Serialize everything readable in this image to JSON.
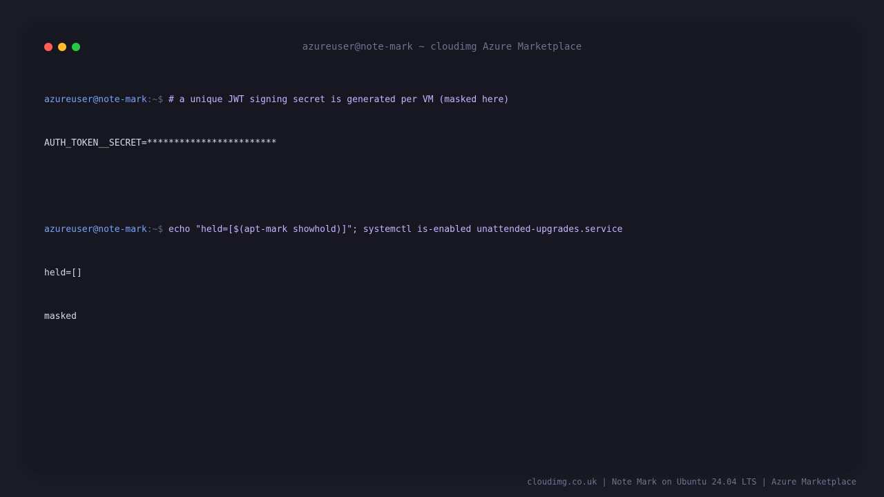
{
  "window": {
    "title": "azureuser@note-mark ~ cloudimg Azure Marketplace",
    "buttons": [
      "close",
      "minimize",
      "maximize"
    ]
  },
  "terminal": {
    "prompt_user": "azureuser@note-mark",
    "prompt_sep": ":~$",
    "lines": [
      {
        "command": "# a unique JWT signing secret is generated per VM (masked here)"
      },
      {
        "output": "AUTH_TOKEN__SECRET=************************"
      },
      {
        "command": "echo \"held=[$(apt-mark showhold)]\"; systemctl is-enabled unattended-upgrades.service"
      },
      {
        "output": "held=[]"
      },
      {
        "output": "masked"
      }
    ]
  },
  "footer": {
    "text": "cloudimg.co.uk | Note Mark on Ubuntu 24.04 LTS | Azure Marketplace"
  },
  "colors": {
    "background": "#1b1c27",
    "window": "#161720",
    "prompt_user": "#7aa2f7",
    "command": "#c7b3ff",
    "output": "#d6d9e4",
    "muted": "#6d7390"
  }
}
